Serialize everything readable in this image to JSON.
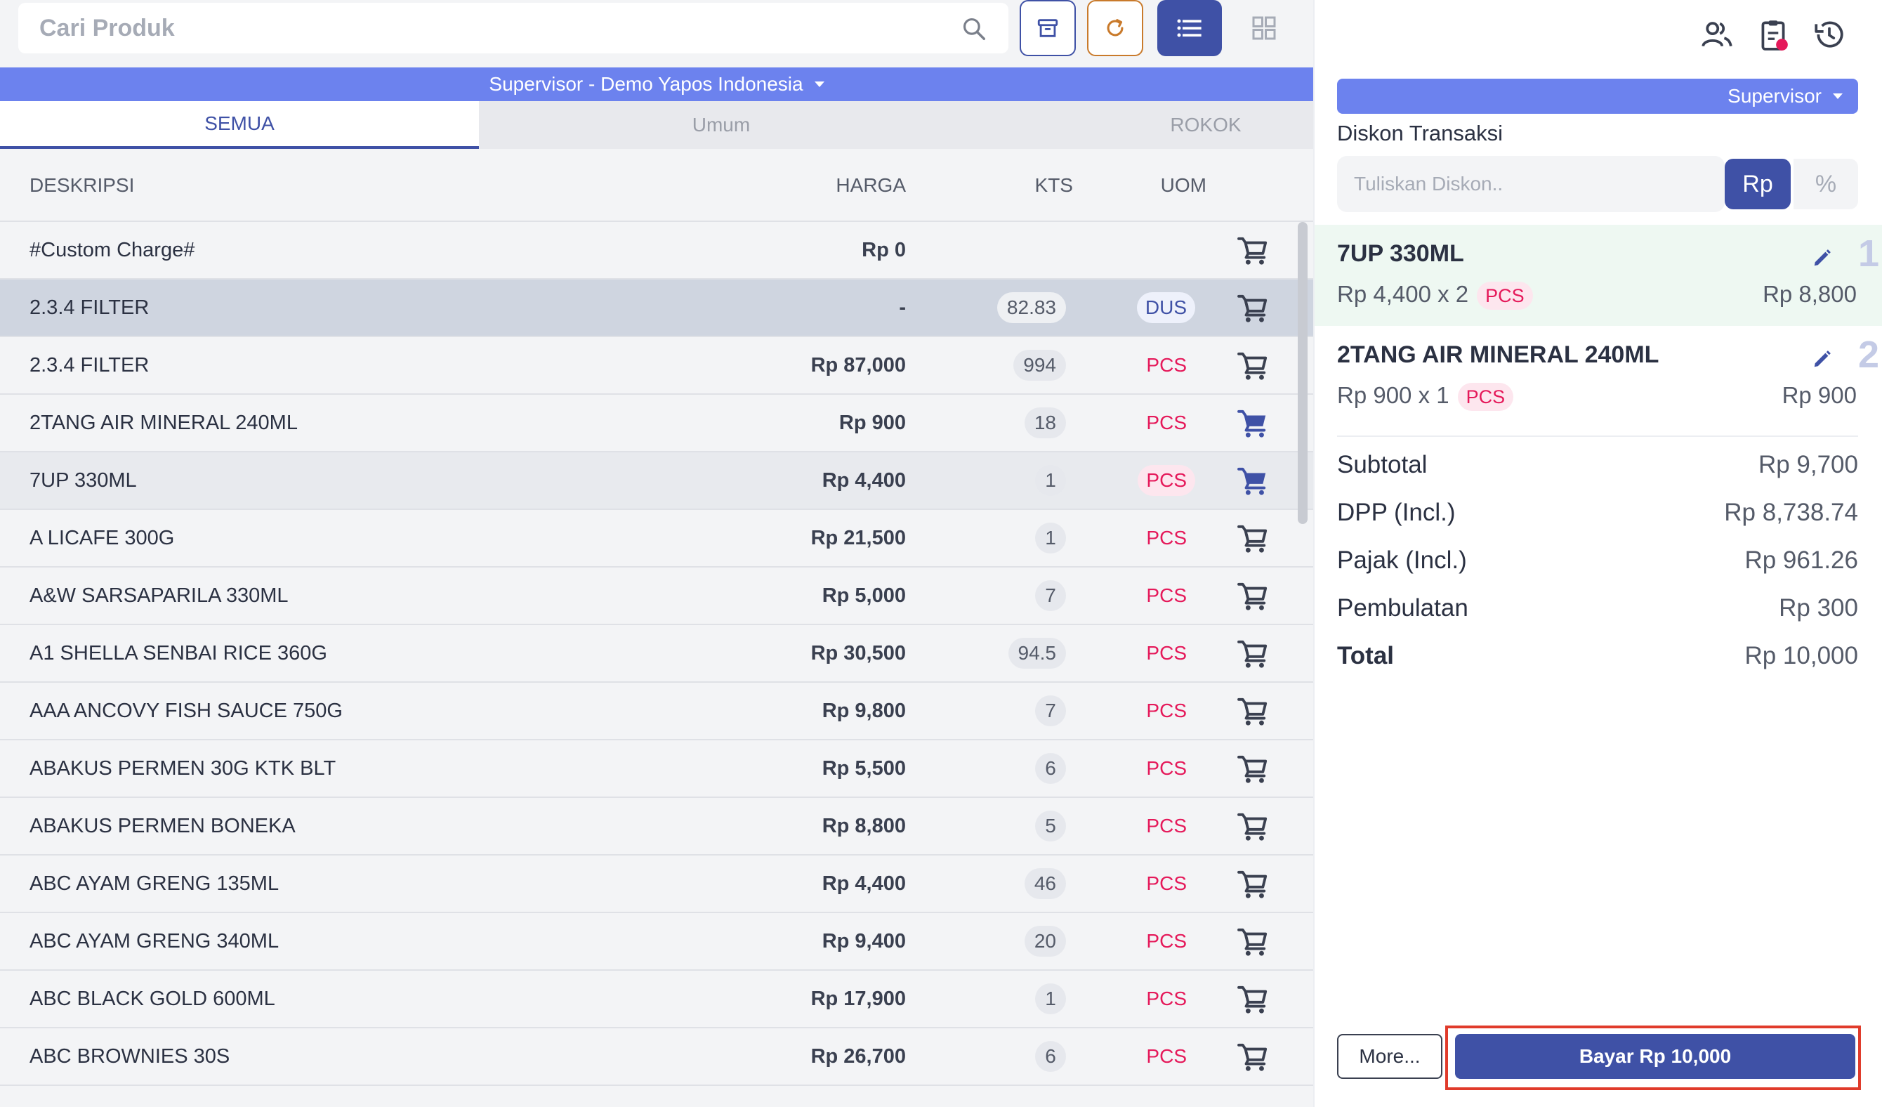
{
  "search": {
    "placeholder": "Cari Produk"
  },
  "header": {
    "store_label": "Supervisor - Demo Yapos Indonesia"
  },
  "tabs": [
    {
      "label": "SEMUA",
      "active": true
    },
    {
      "label": "Umum",
      "active": false
    },
    {
      "label": "ROKOK",
      "active": false
    }
  ],
  "table": {
    "headers": {
      "desc": "DESKRIPSI",
      "price": "HARGA",
      "qty": "KTS",
      "uom": "UOM"
    },
    "rows": [
      {
        "desc": "#Custom Charge#",
        "price": "Rp 0",
        "qty": "",
        "uom": "",
        "in_cart": false,
        "state": "normal"
      },
      {
        "desc": "2.3.4 FILTER",
        "price": "-",
        "qty": "82.83",
        "uom": "DUS",
        "in_cart": false,
        "state": "selected"
      },
      {
        "desc": "2.3.4 FILTER",
        "price": "Rp 87,000",
        "qty": "994",
        "uom": "PCS",
        "in_cart": false,
        "state": "normal"
      },
      {
        "desc": "2TANG AIR MINERAL 240ML",
        "price": "Rp 900",
        "qty": "18",
        "uom": "PCS",
        "in_cart": true,
        "state": "normal"
      },
      {
        "desc": "7UP 330ML",
        "price": "Rp 4,400",
        "qty": "1",
        "uom": "PCS",
        "in_cart": true,
        "state": "highlight"
      },
      {
        "desc": "A LICAFE 300G",
        "price": "Rp 21,500",
        "qty": "1",
        "uom": "PCS",
        "in_cart": false,
        "state": "normal"
      },
      {
        "desc": "A&W SARSAPARILA 330ML",
        "price": "Rp 5,000",
        "qty": "7",
        "uom": "PCS",
        "in_cart": false,
        "state": "normal"
      },
      {
        "desc": "A1 SHELLA SENBAI RICE 360G",
        "price": "Rp 30,500",
        "qty": "94.5",
        "uom": "PCS",
        "in_cart": false,
        "state": "normal"
      },
      {
        "desc": "AAA  ANCOVY  FISH SAUCE 750G",
        "price": "Rp 9,800",
        "qty": "7",
        "uom": "PCS",
        "in_cart": false,
        "state": "normal"
      },
      {
        "desc": "ABAKUS PERMEN 30G KTK BLT",
        "price": "Rp 5,500",
        "qty": "6",
        "uom": "PCS",
        "in_cart": false,
        "state": "normal"
      },
      {
        "desc": "ABAKUS PERMEN BONEKA",
        "price": "Rp 8,800",
        "qty": "5",
        "uom": "PCS",
        "in_cart": false,
        "state": "normal"
      },
      {
        "desc": "ABC AYAM GRENG 135ML",
        "price": "Rp 4,400",
        "qty": "46",
        "uom": "PCS",
        "in_cart": false,
        "state": "normal"
      },
      {
        "desc": "ABC AYAM GRENG 340ML",
        "price": "Rp 9,400",
        "qty": "20",
        "uom": "PCS",
        "in_cart": false,
        "state": "normal"
      },
      {
        "desc": "ABC BLACK GOLD 600ML",
        "price": "Rp 17,900",
        "qty": "1",
        "uom": "PCS",
        "in_cart": false,
        "state": "normal"
      },
      {
        "desc": "ABC BROWNIES 30S",
        "price": "Rp 26,700",
        "qty": "6",
        "uom": "PCS",
        "in_cart": false,
        "state": "normal"
      }
    ]
  },
  "right": {
    "icons": [
      "customers-icon",
      "held-orders-icon",
      "history-icon"
    ],
    "role": "Supervisor",
    "discount": {
      "label": "Diskon Transaksi",
      "placeholder": "Tuliskan Diskon..",
      "rp_label": "Rp",
      "pct_label": "%"
    },
    "cart": [
      {
        "name": "7UP 330ML",
        "line": "Rp 4,400 x 2",
        "uom": "PCS",
        "total": "Rp 8,800",
        "index": "1"
      },
      {
        "name": "2TANG AIR MINERAL 240ML",
        "line": "Rp 900 x 1",
        "uom": "PCS",
        "total": "Rp 900",
        "index": "2"
      }
    ],
    "summary": {
      "subtotal_label": "Subtotal",
      "subtotal": "Rp 9,700",
      "dpp_label": "DPP (Incl.)",
      "dpp": "Rp 8,738.74",
      "tax_label": "Pajak (Incl.)",
      "tax": "Rp 961.26",
      "rounding_label": "Pembulatan",
      "rounding": "Rp 300",
      "total_label": "Total",
      "total": "Rp 10,000"
    },
    "more_label": "More...",
    "pay_label": "Bayar Rp 10,000"
  },
  "colors": {
    "primary": "#3f51a6",
    "accent_bar": "#6c82ee",
    "uom_pink": "#e5195a",
    "refresh_orange": "#c97a2b",
    "highlight_frame": "#e03b2b"
  }
}
